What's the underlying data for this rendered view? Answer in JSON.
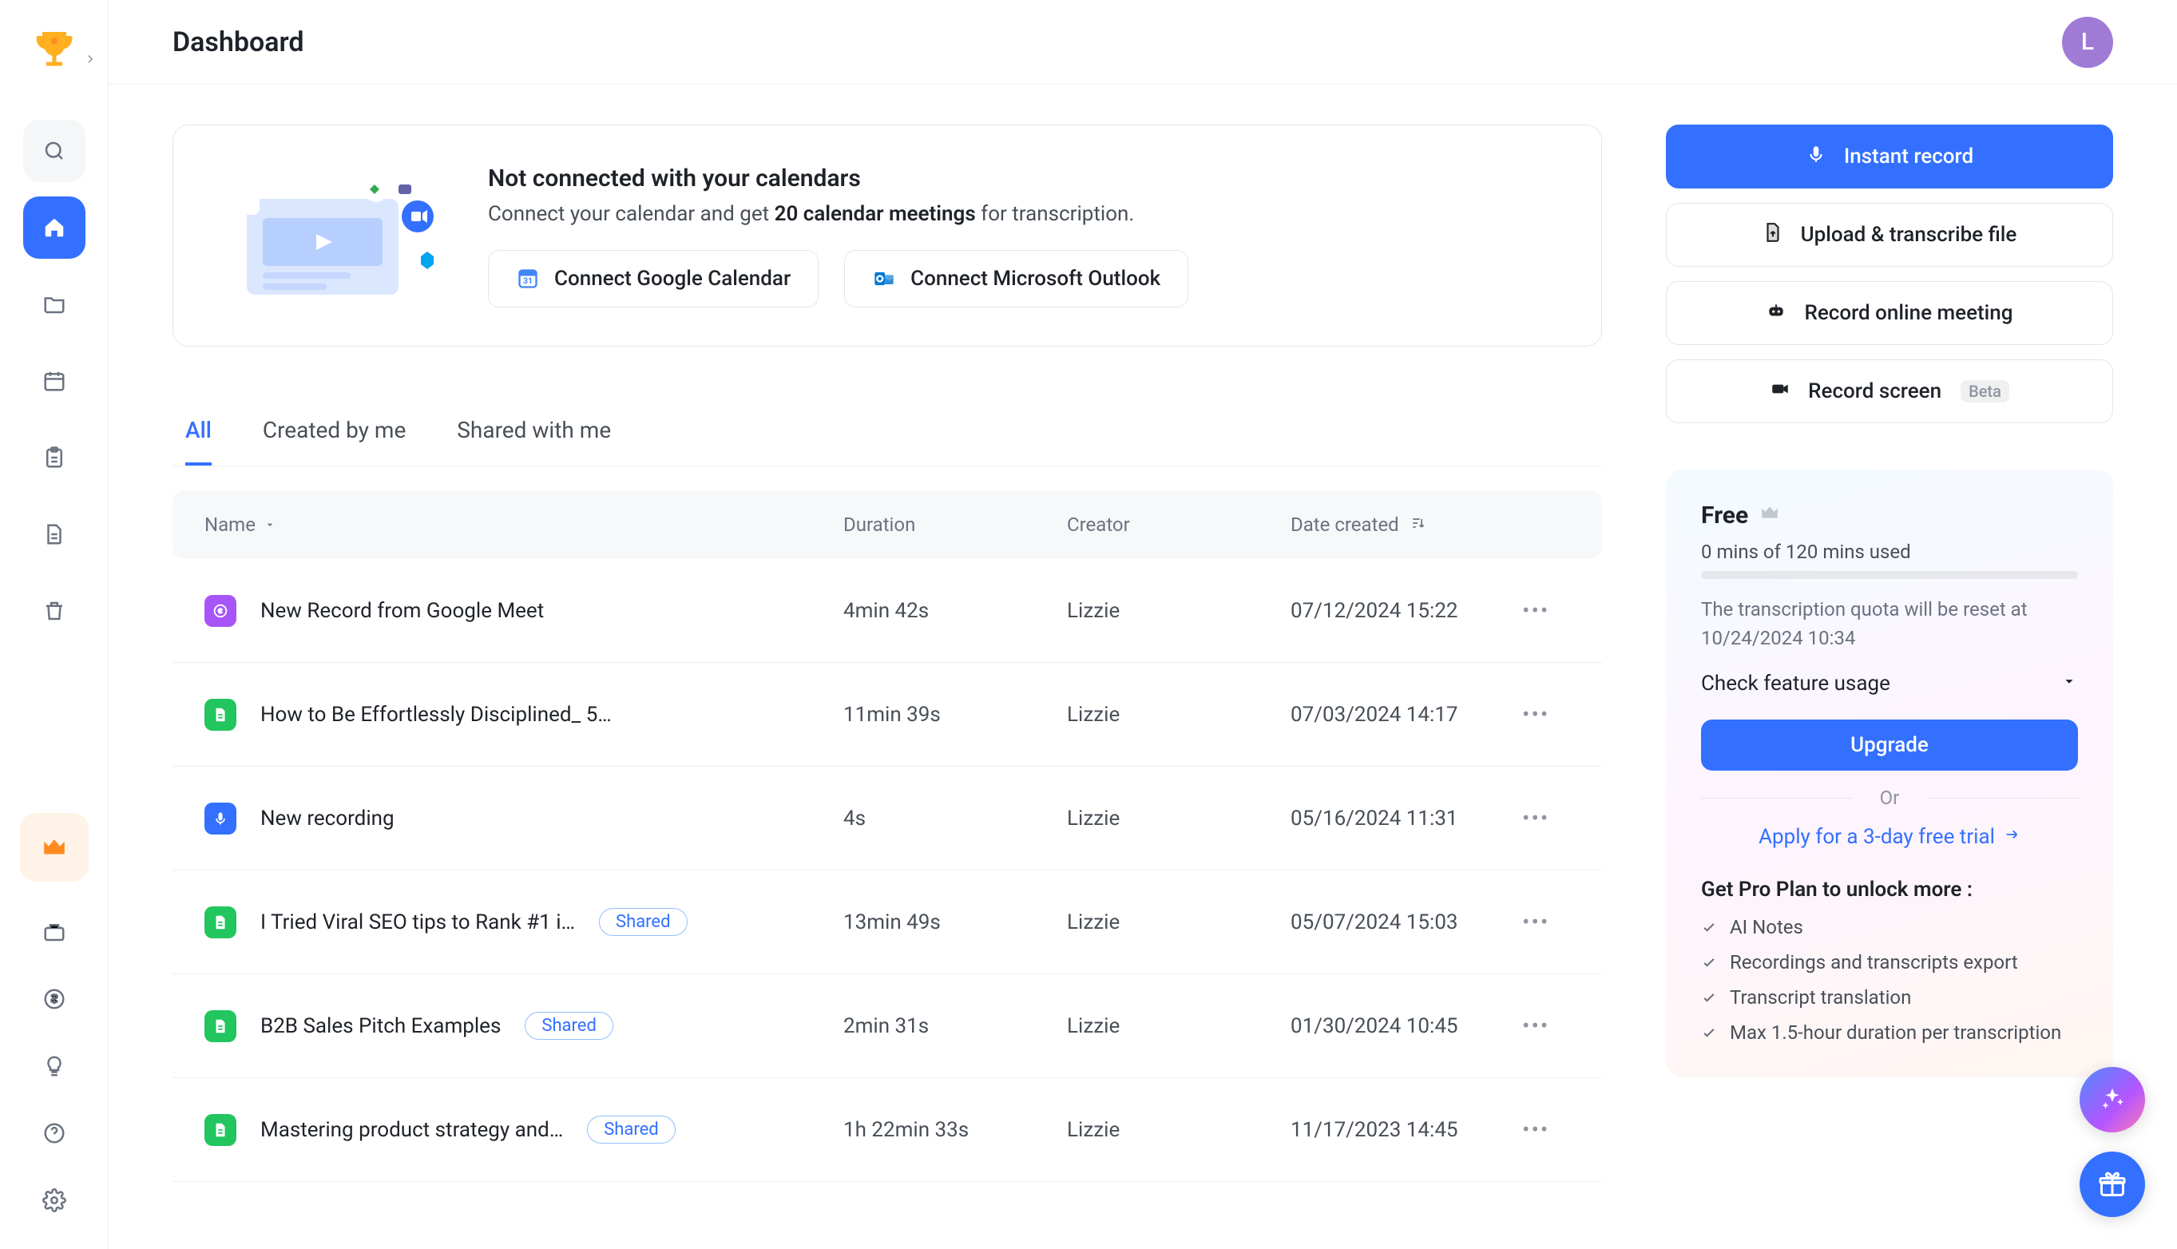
{
  "header": {
    "title": "Dashboard",
    "avatar_initial": "L"
  },
  "sidebar": {
    "top_icons": [
      "trophy-icon"
    ],
    "nav": [
      "search",
      "home",
      "folder",
      "calendar",
      "clipboard",
      "file",
      "trash"
    ],
    "bottom": [
      "crown",
      "briefcase",
      "dollar",
      "lightbulb",
      "help",
      "settings"
    ]
  },
  "banner": {
    "title": "Not connected with your calendars",
    "subtitle_pre": "Connect your calendar and get ",
    "subtitle_bold": "20 calendar meetings",
    "subtitle_post": " for transcription.",
    "google_btn": "Connect Google Calendar",
    "outlook_btn": "Connect Microsoft Outlook"
  },
  "tabs": {
    "all": "All",
    "created": "Created by me",
    "shared": "Shared with me"
  },
  "table": {
    "headers": {
      "name": "Name",
      "duration": "Duration",
      "creator": "Creator",
      "date": "Date created"
    },
    "rows": [
      {
        "icon": "meet",
        "name": "New Record from Google Meet",
        "shared": false,
        "duration": "4min 42s",
        "creator": "Lizzie",
        "date": "07/12/2024 15:22"
      },
      {
        "icon": "doc",
        "name": "How to Be Effortlessly Disciplined_ 5…",
        "shared": false,
        "duration": "11min 39s",
        "creator": "Lizzie",
        "date": "07/03/2024 14:17"
      },
      {
        "icon": "mic",
        "name": "New recording",
        "shared": false,
        "duration": "4s",
        "creator": "Lizzie",
        "date": "05/16/2024 11:31"
      },
      {
        "icon": "doc",
        "name": "I Tried Viral SEO tips to Rank #1 i…",
        "shared": true,
        "duration": "13min 49s",
        "creator": "Lizzie",
        "date": "05/07/2024 15:03"
      },
      {
        "icon": "doc",
        "name": "B2B Sales Pitch Examples",
        "shared": true,
        "duration": "2min 31s",
        "creator": "Lizzie",
        "date": "01/30/2024 10:45"
      },
      {
        "icon": "doc",
        "name": "Mastering product strategy and…",
        "shared": true,
        "duration": "1h 22min 33s",
        "creator": "Lizzie",
        "date": "11/17/2023 14:45"
      }
    ],
    "shared_label": "Shared"
  },
  "actions": {
    "instant": "Instant record",
    "upload": "Upload & transcribe file",
    "online": "Record online meeting",
    "screen": "Record screen",
    "beta": "Beta"
  },
  "plan": {
    "name": "Free",
    "usage": "0 mins of 120 mins used",
    "reset": "The transcription quota will be reset at 10/24/2024 10:34",
    "feature_toggle": "Check feature usage",
    "upgrade": "Upgrade",
    "or": "Or",
    "trial": "Apply for a 3-day free trial",
    "pro_title": "Get Pro Plan to unlock more :",
    "pro_items": [
      "AI Notes",
      "Recordings and transcripts export",
      "Transcript translation",
      "Max 1.5-hour duration per transcription"
    ]
  }
}
